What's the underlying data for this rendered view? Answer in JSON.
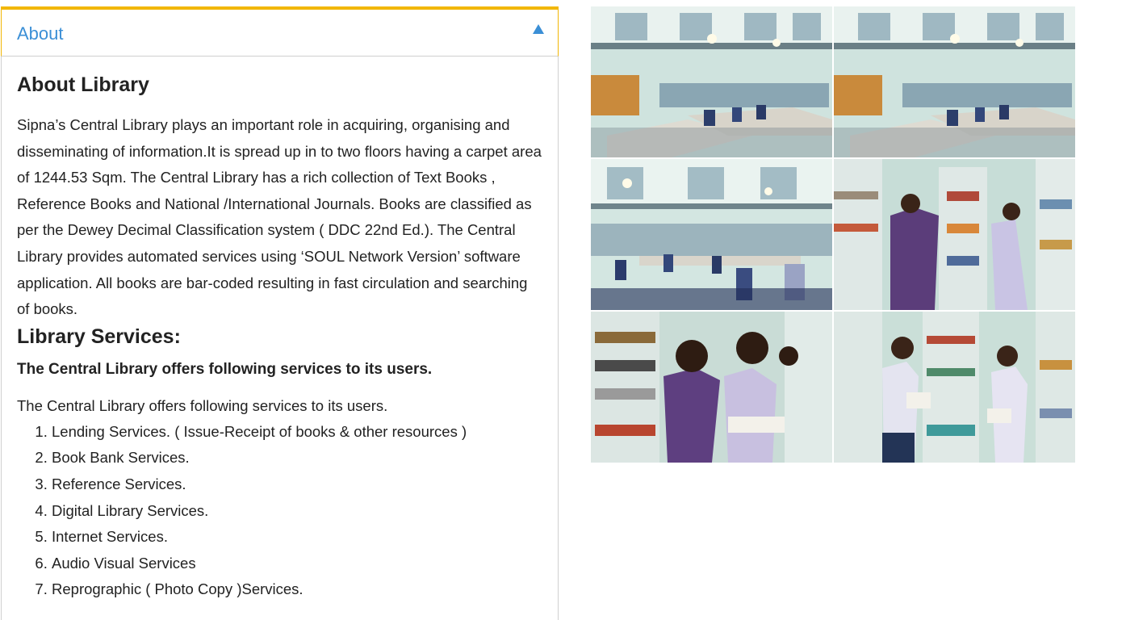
{
  "accordion": {
    "header_label": "About",
    "about_heading": "About Library",
    "about_text": "Sipna’s  Central Library plays an important role in acquiring, organising and disseminating of information.It is spread up in to two floors  having a carpet area of 1244.53 Sqm. The Central Library has a rich collection of  Text Books , Reference Books and National /International Journals.  Books are classified as per the Dewey Decimal Classification system ( DDC 22nd Ed.). The Central Library provides  automated services using ‘SOUL Network Version’ software application. All books are bar-coded resulting in fast circulation and searching of books.",
    "services_heading": "Library Services:",
    "services_bold": "The Central Library offers following services to its users.",
    "services_intro": "The Central Library offers following services to its users.",
    "services": [
      "Lending Services. ( Issue-Receipt of books & other resources )",
      "Book Bank Services.",
      "Reference Services.",
      "Digital Library Services.",
      "Internet Services.",
      "Audio Visual Services",
      "Reprographic ( Photo Copy )Services."
    ]
  },
  "gallery": {
    "photos": [
      {
        "scene": "reading-hall"
      },
      {
        "scene": "reading-hall"
      },
      {
        "scene": "reading-hall-students"
      },
      {
        "scene": "stacks-students"
      },
      {
        "scene": "stacks-closeup"
      },
      {
        "scene": "stacks-readers"
      }
    ]
  },
  "colors": {
    "accent_border": "#f2b705",
    "header_text": "#3b8fd6",
    "body_text": "#222222"
  }
}
